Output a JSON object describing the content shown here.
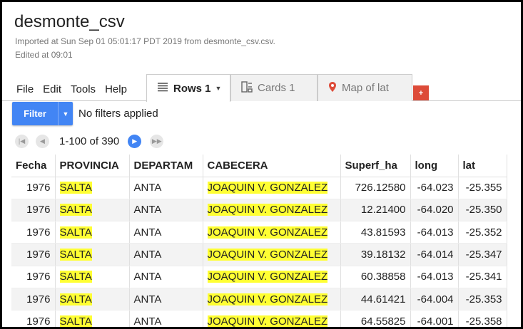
{
  "header": {
    "title": "desmonte_csv",
    "imported": "Imported at Sun Sep 01 05:01:17 PDT 2019 from desmonte_csv.csv.",
    "edited": "Edited at 09:01"
  },
  "menu": [
    "File",
    "Edit",
    "Tools",
    "Help"
  ],
  "tabs": [
    {
      "label": "Rows 1",
      "icon": "list-icon",
      "active": true
    },
    {
      "label": "Cards 1",
      "icon": "cards-icon",
      "active": false
    },
    {
      "label": "Map of lat",
      "icon": "map-pin-icon",
      "active": false
    }
  ],
  "add_tab_label": "+",
  "filter": {
    "button_label": "Filter",
    "status": "No filters applied"
  },
  "pager": {
    "range": "1-100 of 390"
  },
  "table": {
    "columns": [
      "Fecha",
      "PROVINCIA",
      "DEPARTAM",
      "CABECERA",
      "Superf_ha",
      "long",
      "lat"
    ],
    "rows": [
      [
        "1976",
        "SALTA",
        "ANTA",
        "JOAQUIN V. GONZALEZ",
        "726.12580",
        "-64.023",
        "-25.355"
      ],
      [
        "1976",
        "SALTA",
        "ANTA",
        "JOAQUIN V. GONZALEZ",
        "12.21400",
        "-64.020",
        "-25.350"
      ],
      [
        "1976",
        "SALTA",
        "ANTA",
        "JOAQUIN V. GONZALEZ",
        "43.81593",
        "-64.013",
        "-25.352"
      ],
      [
        "1976",
        "SALTA",
        "ANTA",
        "JOAQUIN V. GONZALEZ",
        "39.18132",
        "-64.014",
        "-25.347"
      ],
      [
        "1976",
        "SALTA",
        "ANTA",
        "JOAQUIN V. GONZALEZ",
        "60.38858",
        "-64.013",
        "-25.341"
      ],
      [
        "1976",
        "SALTA",
        "ANTA",
        "JOAQUIN V. GONZALEZ",
        "44.61421",
        "-64.004",
        "-25.353"
      ],
      [
        "1976",
        "SALTA",
        "ANTA",
        "JOAQUIN V. GONZALEZ",
        "64.55825",
        "-64.001",
        "-25.358"
      ]
    ]
  },
  "colors": {
    "accent": "#4285f4",
    "highlight": "#ffff33",
    "add_tab": "#dd4b39"
  }
}
